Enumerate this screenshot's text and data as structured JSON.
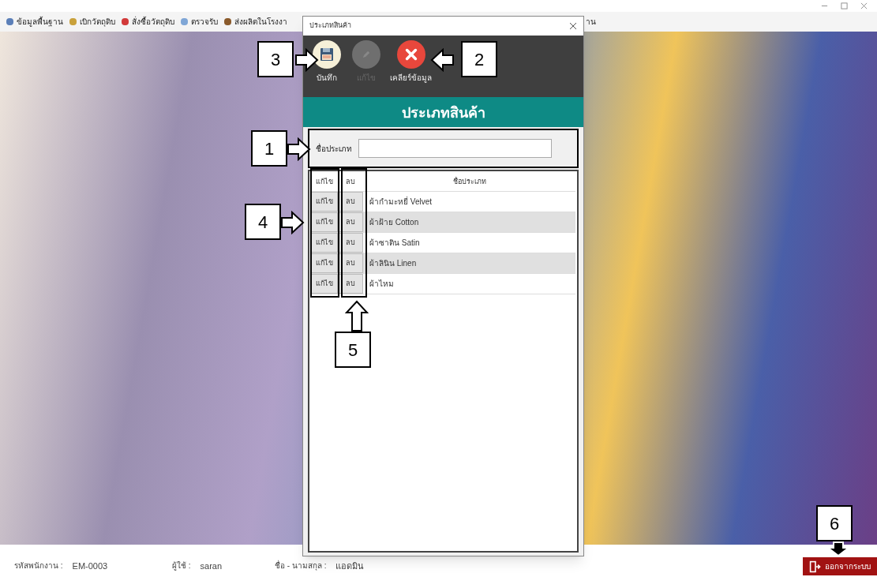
{
  "menu": [
    {
      "label": "ข้อมูลพื้นฐาน",
      "color": "#5b7fb8"
    },
    {
      "label": "เบิกวัตถุดิบ",
      "color": "#c9a13b"
    },
    {
      "label": "สั่งซื้อวัตถุดิบ",
      "color": "#d23a3a"
    },
    {
      "label": "ตรวจรับ",
      "color": "#7fa6d6"
    },
    {
      "label": "ส่งผลิตในโรงงา",
      "color": "#8a5a2b"
    },
    {
      "label": "าน"
    }
  ],
  "dialog": {
    "title": "ประเภทสินค้า",
    "toolbar": [
      {
        "kind": "save",
        "label": "บันทึก",
        "disabled": false
      },
      {
        "kind": "edit",
        "label": "แก้ไข",
        "disabled": true
      },
      {
        "kind": "clear",
        "label": "เคลียร์ข้อมูล",
        "disabled": false
      }
    ],
    "header": "ประเภทสินค้า",
    "field": {
      "label": "ชื่อประเภท"
    },
    "table": {
      "columns": [
        "แก้ไข",
        "ลบ",
        "ชื่อประเภท"
      ],
      "rows": [
        {
          "edit": "แก้ไข",
          "delete": "ลบ",
          "name": "ผ้ากำมะหยี่ Velvet"
        },
        {
          "edit": "แก้ไข",
          "delete": "ลบ",
          "name": "ผ้าฝ้าย Cotton"
        },
        {
          "edit": "แก้ไข",
          "delete": "ลบ",
          "name": "ผ้าซาติน Satin"
        },
        {
          "edit": "แก้ไข",
          "delete": "ลบ",
          "name": "ผ้าลินิน Linen"
        },
        {
          "edit": "แก้ไข",
          "delete": "ลบ",
          "name": "ผ้าไหม"
        }
      ]
    }
  },
  "status_bar": [
    {
      "label": "รหัสพนักงาน :",
      "value": "EM-0003"
    },
    {
      "label": "ผู้ใช้ :",
      "value": "saran"
    },
    {
      "label": "ชื่อ - นามสกุล :",
      "value": "แอดมิน"
    }
  ],
  "logout": "ออกจากระบบ",
  "annotations": [
    "1",
    "2",
    "3",
    "4",
    "5",
    "6"
  ]
}
